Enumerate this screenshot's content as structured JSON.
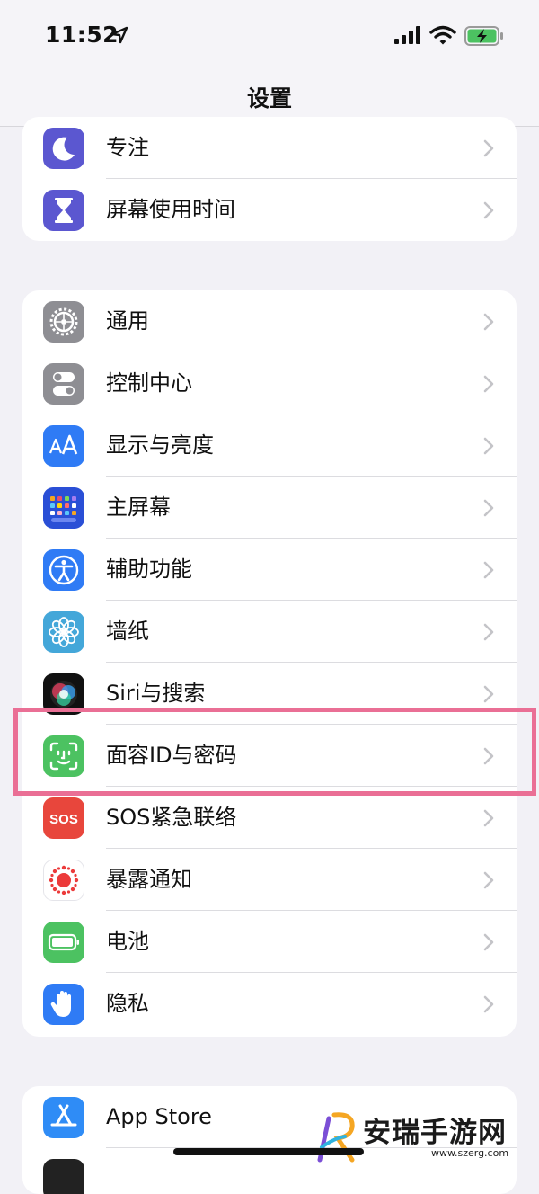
{
  "status_bar": {
    "time": "11:52"
  },
  "nav": {
    "title": "设置"
  },
  "group1": {
    "items": [
      {
        "label": "专注",
        "icon": "moon-icon",
        "color": "#5b57d0"
      },
      {
        "label": "屏幕使用时间",
        "icon": "hourglass-icon",
        "color": "#5b57d0"
      }
    ]
  },
  "group2": {
    "items": [
      {
        "label": "通用",
        "icon": "gear-icon",
        "color": "#8e8e93"
      },
      {
        "label": "控制中心",
        "icon": "toggles-icon",
        "color": "#8e8e93"
      },
      {
        "label": "显示与亮度",
        "icon": "text-size-icon",
        "color": "#2f7bf5"
      },
      {
        "label": "主屏幕",
        "icon": "home-grid-icon",
        "color": "#2a4fd6"
      },
      {
        "label": "辅助功能",
        "icon": "accessibility-icon",
        "color": "#2f7bf5"
      },
      {
        "label": "墙纸",
        "icon": "flower-icon",
        "color": "#44a7d9"
      },
      {
        "label": "Siri与搜索",
        "icon": "siri-icon",
        "color": "#111111"
      },
      {
        "label": "面容ID与密码",
        "icon": "face-id-icon",
        "color": "#4cc261"
      },
      {
        "label": "SOS紧急联络",
        "icon": "sos-icon",
        "color": "#e8463c",
        "icon_text": "SOS"
      },
      {
        "label": "暴露通知",
        "icon": "exposure-icon",
        "color": "#ffffff"
      },
      {
        "label": "电池",
        "icon": "battery-icon",
        "color": "#4cc261"
      },
      {
        "label": "隐私",
        "icon": "hand-icon",
        "color": "#2f7bf5"
      }
    ]
  },
  "group3": {
    "items": [
      {
        "label": "App Store",
        "icon": "app-store-icon",
        "color": "#2f8cf6"
      }
    ]
  },
  "watermark": {
    "text": "安瑞手游网",
    "url": "www.szerg.com"
  }
}
